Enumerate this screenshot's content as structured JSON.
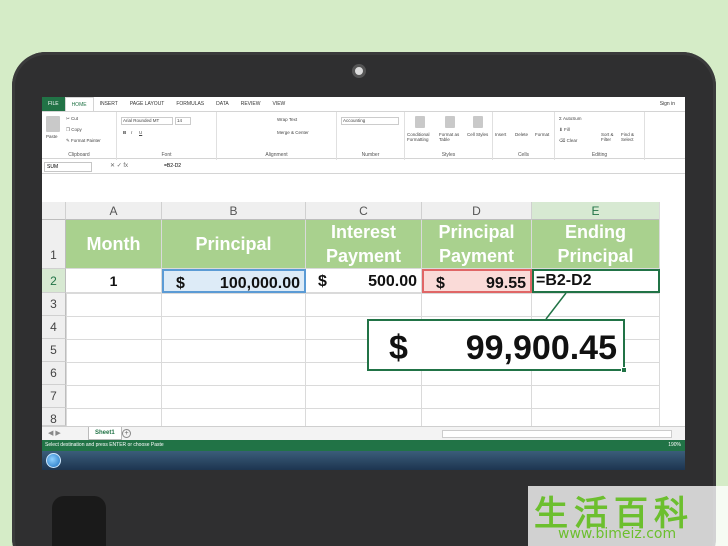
{
  "ribbon": {
    "tabs": [
      "FILE",
      "HOME",
      "INSERT",
      "PAGE LAYOUT",
      "FORMULAS",
      "DATA",
      "REVIEW",
      "VIEW"
    ],
    "sign_in": "Sign in",
    "groups": {
      "clipboard": {
        "label": "Clipboard",
        "paste": "Paste",
        "cut": "Cut",
        "copy": "Copy",
        "format_painter": "Format Painter"
      },
      "font": {
        "label": "Font",
        "font_name": "Arial Rounded MT",
        "font_size": "14"
      },
      "alignment": {
        "label": "Alignment",
        "wrap": "Wrap Text",
        "merge": "Merge & Center"
      },
      "number": {
        "label": "Number",
        "format": "Accounting"
      },
      "styles": {
        "label": "Styles",
        "conditional": "Conditional Formatting",
        "format_table": "Format as Table",
        "cell_styles": "Cell Styles"
      },
      "cells": {
        "label": "Cells",
        "insert": "Insert",
        "delete": "Delete",
        "format": "Format"
      },
      "editing": {
        "label": "Editing",
        "autosum": "AutoSum",
        "fill": "Fill",
        "clear": "Clear",
        "sort": "Sort & Filter",
        "find": "Find & Select"
      }
    }
  },
  "formula_bar": {
    "name_box": "SUM",
    "fx": "fx",
    "formula": "=B2-D2"
  },
  "columns": [
    "A",
    "B",
    "C",
    "D",
    "E"
  ],
  "rows": [
    "1",
    "2",
    "3",
    "4",
    "5",
    "6",
    "7",
    "8"
  ],
  "header_row": {
    "A": [
      "Month"
    ],
    "B": [
      "Principal"
    ],
    "C": [
      "Interest",
      "Payment"
    ],
    "D": [
      "Principal",
      "Payment"
    ],
    "E": [
      "Ending",
      "Principal"
    ]
  },
  "row2": {
    "A": "1",
    "B": {
      "sym": "$",
      "num": "100,000.00"
    },
    "C": {
      "sym": "$",
      "num": "500.00"
    },
    "D": {
      "sym": "$",
      "num": "99.55"
    },
    "E": "=B2-D2"
  },
  "callout": {
    "sym": "$",
    "num": "99,900.45"
  },
  "sheet_tab": "Sheet1",
  "status_text": "Select destination and press ENTER or choose Paste",
  "zoom_level": "190%",
  "watermark": {
    "text": "生活百科",
    "url": "www.bimeiz.com"
  },
  "colors": {
    "header_fill": "#a9d18e",
    "excel_green": "#217346",
    "selected_b2": "#ddebf7",
    "selected_d2": "#fadbd8"
  }
}
